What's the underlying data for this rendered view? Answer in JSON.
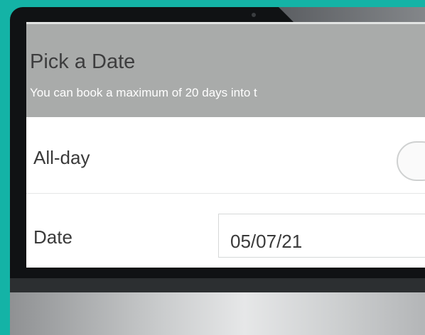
{
  "header": {
    "title": "Pick a Date",
    "subtitle": "You can book a maximum of 20 days into t"
  },
  "rows": {
    "allday": {
      "label": "All-day",
      "toggle_on": false
    },
    "date": {
      "label": "Date",
      "value": "05/07/21"
    }
  },
  "colors": {
    "background": "#14b3a6",
    "header": "#a9abaa",
    "bezel": "#101214"
  }
}
